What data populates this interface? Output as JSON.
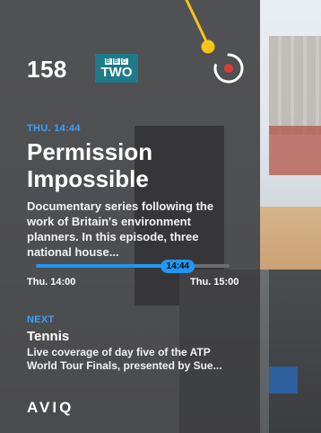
{
  "colors": {
    "accent": "#2196f3",
    "time_label": "#3aa0ff",
    "record_red": "#e53935",
    "pointer_yellow": "#f5c518",
    "panel_bg": "#3a3a3c"
  },
  "channel": {
    "number": "158",
    "logo_top": "BBC",
    "logo_bottom": "TWO",
    "icon": "bbc-two-logo"
  },
  "record": {
    "icon": "record-icon"
  },
  "current": {
    "time_label": "THU. 14:44",
    "title": "Permission Impossible",
    "description": "Documentary series following the work of Britain's environment planners. In this episode, three national house..."
  },
  "progress": {
    "current_time": "14:44",
    "start": "Thu. 14:00",
    "end": "Thu. 15:00",
    "fraction": 0.733
  },
  "next": {
    "label": "NEXT",
    "title": "Tennis",
    "description": "Live coverage of day five of the ATP World Tour Finals, presented by Sue..."
  },
  "brand": {
    "name": "AVIQ"
  }
}
